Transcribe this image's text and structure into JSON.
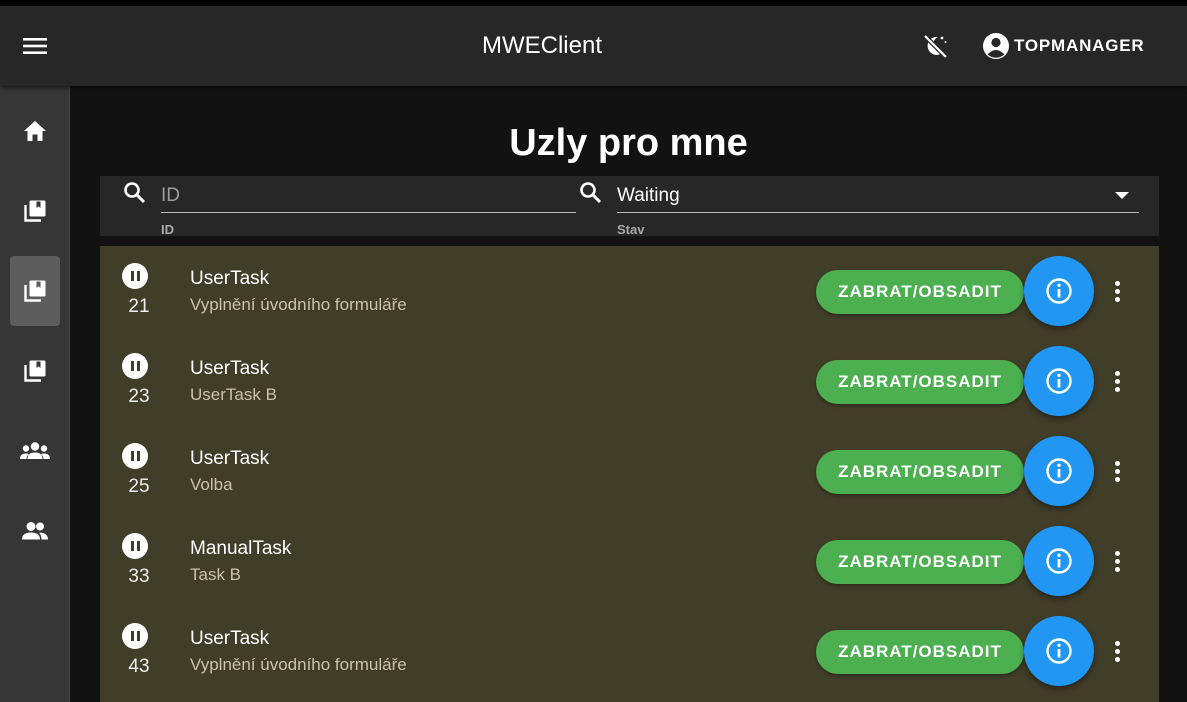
{
  "app": {
    "title": "MWEClient"
  },
  "user": {
    "name": "TOPMANAGER"
  },
  "page": {
    "title": "Uzly pro mne"
  },
  "filters": {
    "id": {
      "placeholder": "ID",
      "label": "ID"
    },
    "status": {
      "value": "Waiting",
      "label": "Stav"
    }
  },
  "sidebar": {
    "items": [
      {
        "icon": "home-icon"
      },
      {
        "icon": "library-books-icon"
      },
      {
        "icon": "library-books-icon",
        "active": true
      },
      {
        "icon": "library-books-icon"
      },
      {
        "icon": "groups-icon"
      },
      {
        "icon": "people-icon"
      }
    ]
  },
  "tasks": [
    {
      "id": "21",
      "type": "UserTask",
      "name": "Vyplnění úvodního formuláře",
      "action": "ZABRAT/OBSADIT"
    },
    {
      "id": "23",
      "type": "UserTask",
      "name": "UserTask B",
      "action": "ZABRAT/OBSADIT"
    },
    {
      "id": "25",
      "type": "UserTask",
      "name": "Volba",
      "action": "ZABRAT/OBSADIT"
    },
    {
      "id": "33",
      "type": "ManualTask",
      "name": "Task B",
      "action": "ZABRAT/OBSADIT"
    },
    {
      "id": "43",
      "type": "UserTask",
      "name": "Vyplnění úvodního formuláře",
      "action": "ZABRAT/OBSADIT"
    }
  ],
  "colors": {
    "appbar": "#272727",
    "sidebar": "#363636",
    "list_background": "#403d28",
    "claim_button": "#4caf50",
    "info_button": "#2196f3"
  }
}
